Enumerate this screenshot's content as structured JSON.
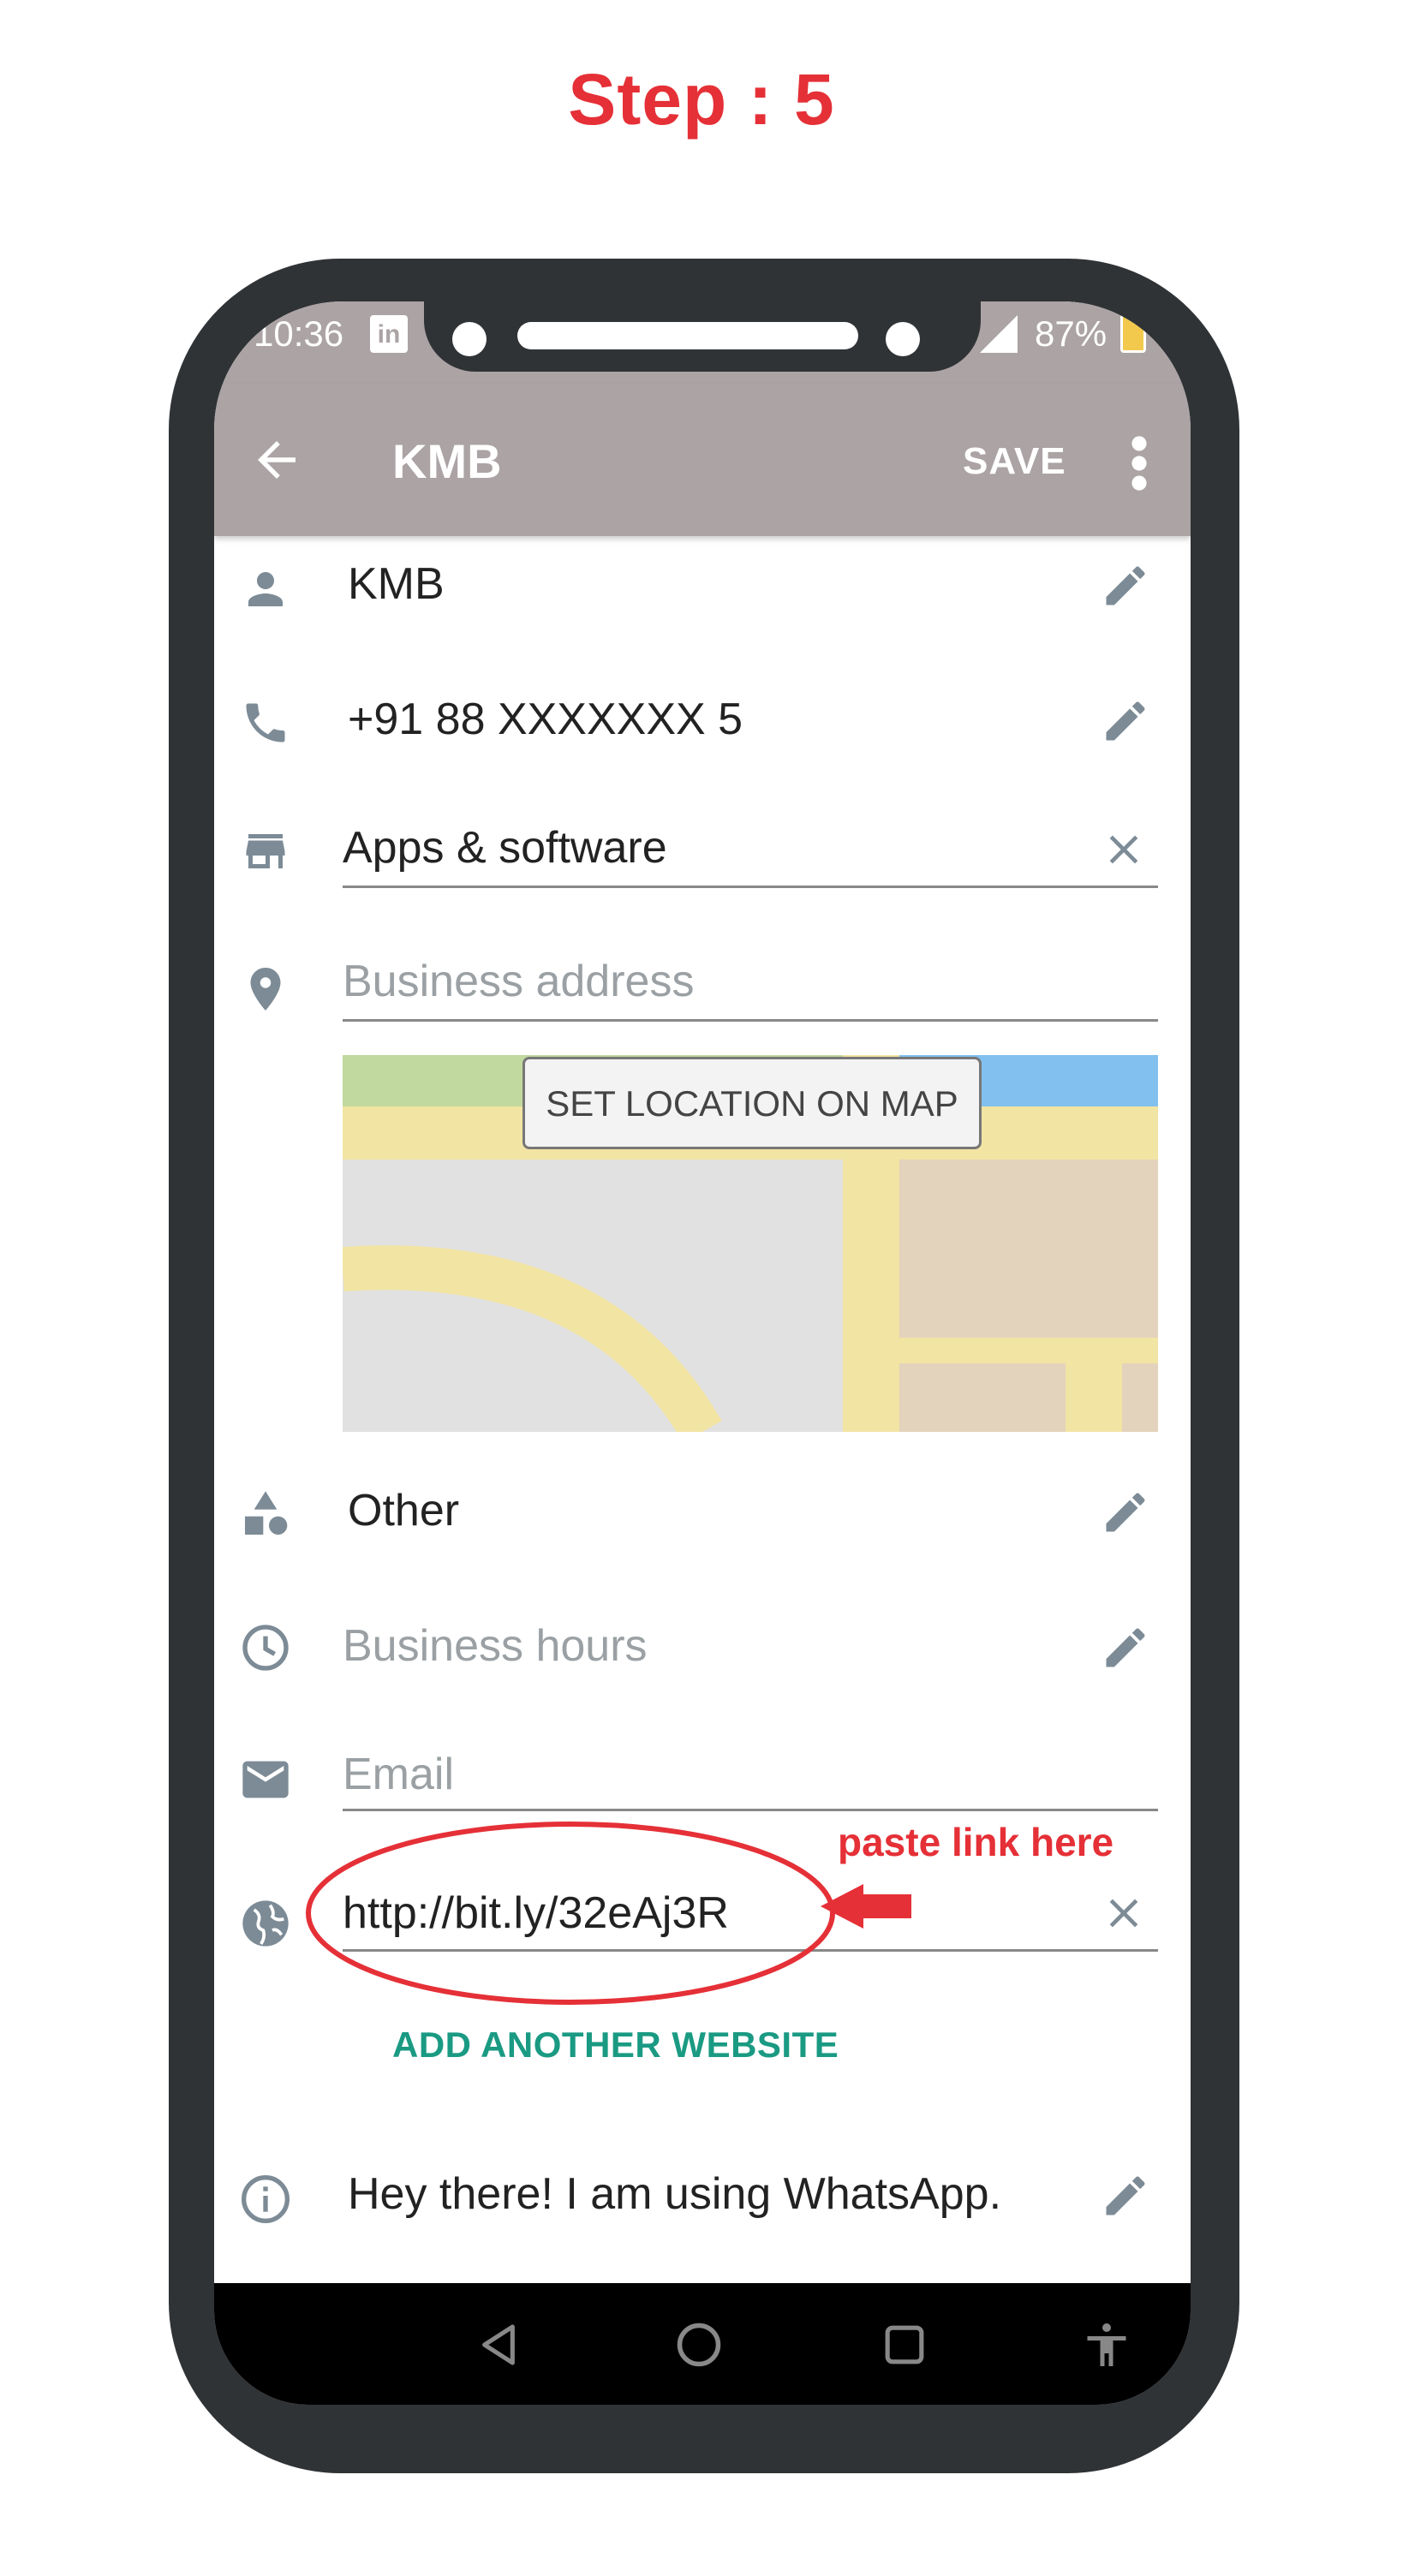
{
  "step_title": "Step : 5",
  "status_bar": {
    "time": "10:36",
    "battery": "87%",
    "notification_icon": "linkedin-icon",
    "notification_label": "in"
  },
  "app_bar": {
    "title": "KMB",
    "save_label": "SAVE",
    "back_icon": "arrow-left-icon",
    "menu_icon": "more-vert-icon"
  },
  "profile": {
    "name": "KMB",
    "phone": "+91 88 XXXXXXX 5",
    "category": "Apps & software",
    "address_placeholder": "Business address",
    "set_location_label": "SET LOCATION ON MAP",
    "description": "Other",
    "hours_placeholder": "Business hours",
    "email_placeholder": "Email",
    "website": "http://bit.ly/32eAj3R",
    "add_website_label": "ADD ANOTHER WEBSITE",
    "about": "Hey there! I am using WhatsApp."
  },
  "annotation": {
    "text": "paste link here",
    "color": "#e53037"
  },
  "colors": {
    "app_bar": "#aba3a4",
    "icon": "#7c8b96",
    "accent": "#1a9a83",
    "phone_frame": "#303336"
  },
  "nav_bar": {
    "icons": [
      "back-triangle-icon",
      "home-circle-icon",
      "recents-square-icon",
      "accessibility-icon"
    ]
  }
}
